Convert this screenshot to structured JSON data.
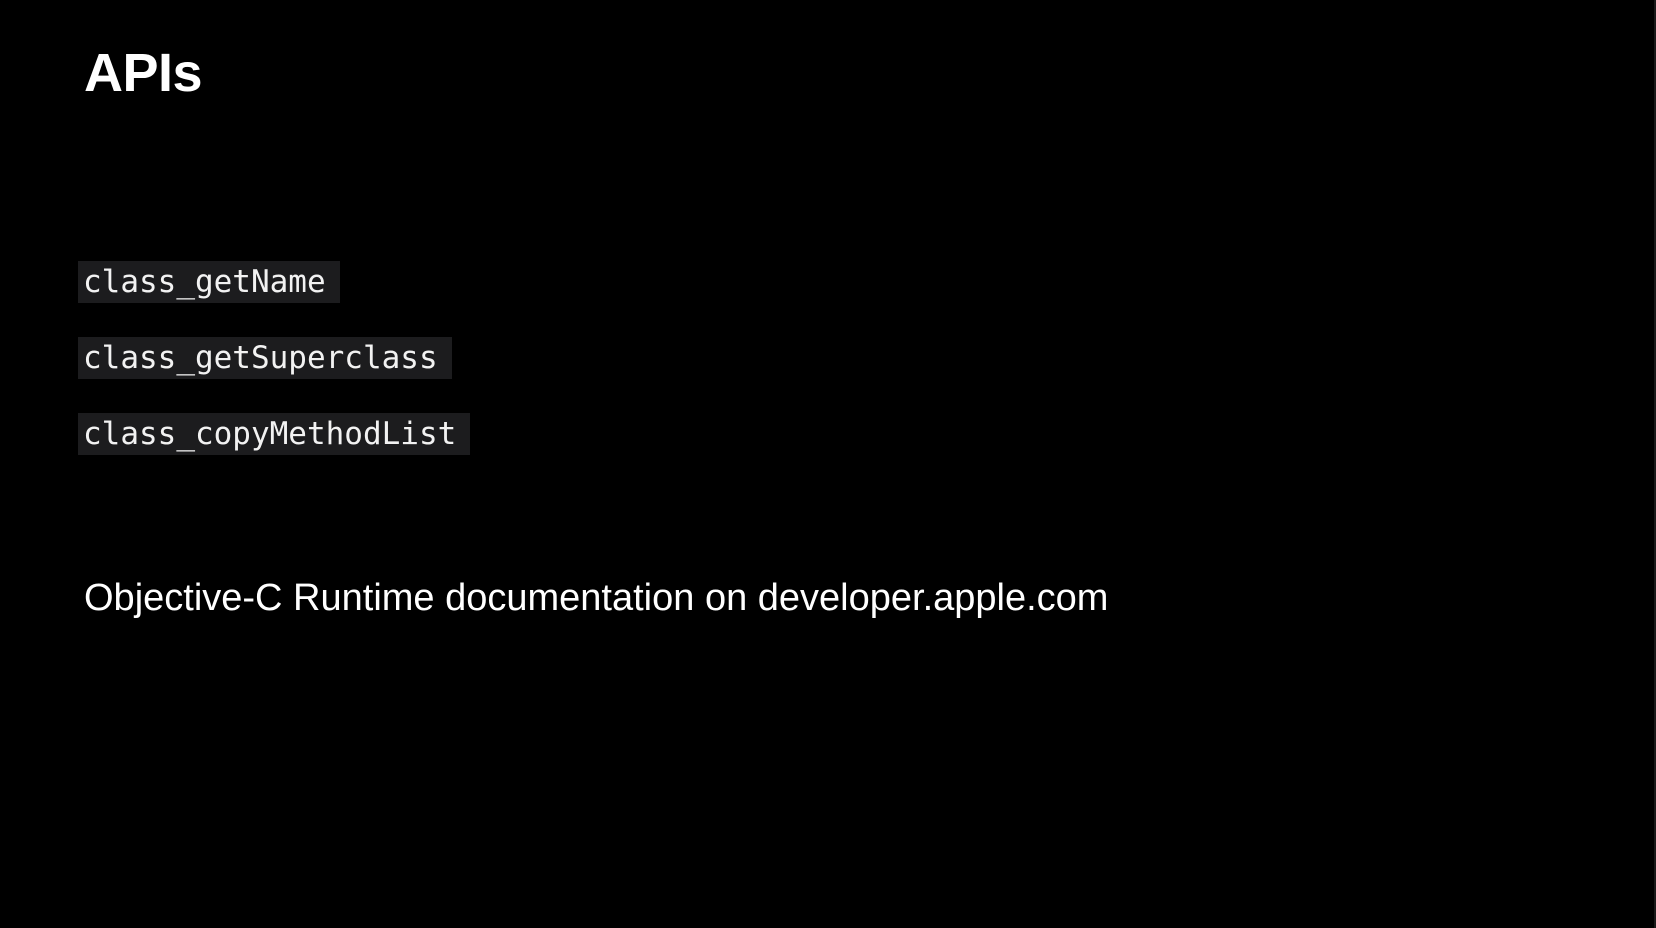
{
  "slide": {
    "title": "APIs",
    "apis": [
      {
        "name": "class_getName"
      },
      {
        "name": "class_getSuperclass"
      },
      {
        "name": "class_copyMethodList"
      }
    ],
    "note": "Objective-C Runtime documentation on developer.apple.com"
  },
  "colors": {
    "background": "#000000",
    "text": "#ffffff",
    "code_background": "#1c1c1e"
  }
}
